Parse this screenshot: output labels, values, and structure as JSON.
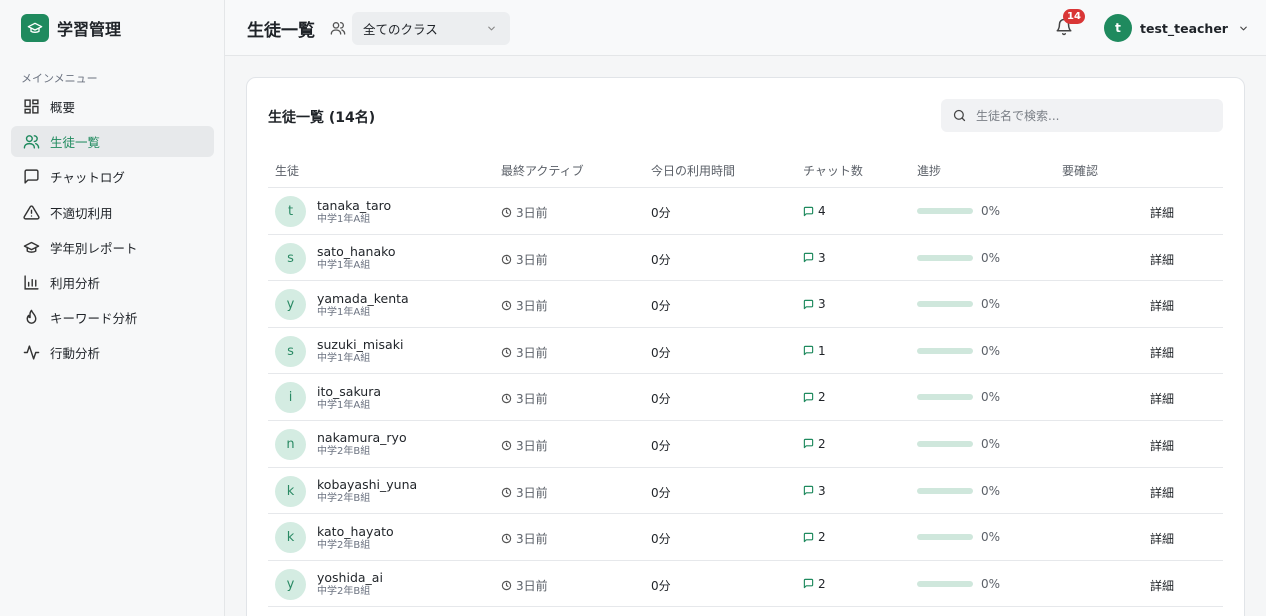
{
  "brand": {
    "title": "学習管理"
  },
  "sidebar": {
    "heading": "メインメニュー",
    "items": [
      {
        "label": "概要",
        "icon": "dashboard-icon",
        "active": false
      },
      {
        "label": "生徒一覧",
        "icon": "users-icon",
        "active": true
      },
      {
        "label": "チャットログ",
        "icon": "chat-icon",
        "active": false
      },
      {
        "label": "不適切利用",
        "icon": "warning-icon",
        "active": false
      },
      {
        "label": "学年別レポート",
        "icon": "graduation-cap-icon",
        "active": false
      },
      {
        "label": "利用分析",
        "icon": "bar-chart-icon",
        "active": false
      },
      {
        "label": "キーワード分析",
        "icon": "flame-icon",
        "active": false
      },
      {
        "label": "行動分析",
        "icon": "activity-icon",
        "active": false
      }
    ]
  },
  "header": {
    "title": "生徒一覧",
    "class_filter": "全てのクラス",
    "notifications": "14",
    "user_initial": "t",
    "user_name": "test_teacher"
  },
  "card": {
    "title": "生徒一覧 (14名)",
    "search_placeholder": "生徒名で検索...",
    "columns": [
      "生徒",
      "最終アクティブ",
      "今日の利用時間",
      "チャット数",
      "進捗",
      "要確認"
    ],
    "rows": [
      {
        "initial": "t",
        "name": "tanaka_taro",
        "class": "中学1年A組",
        "last_active": "3日前",
        "usage": "0分",
        "chats": "4",
        "progress": 0,
        "progress_label": "0%",
        "action": "詳細"
      },
      {
        "initial": "s",
        "name": "sato_hanako",
        "class": "中学1年A組",
        "last_active": "3日前",
        "usage": "0分",
        "chats": "3",
        "progress": 0,
        "progress_label": "0%",
        "action": "詳細"
      },
      {
        "initial": "y",
        "name": "yamada_kenta",
        "class": "中学1年A組",
        "last_active": "3日前",
        "usage": "0分",
        "chats": "3",
        "progress": 0,
        "progress_label": "0%",
        "action": "詳細"
      },
      {
        "initial": "s",
        "name": "suzuki_misaki",
        "class": "中学1年A組",
        "last_active": "3日前",
        "usage": "0分",
        "chats": "1",
        "progress": 0,
        "progress_label": "0%",
        "action": "詳細"
      },
      {
        "initial": "i",
        "name": "ito_sakura",
        "class": "中学1年A組",
        "last_active": "3日前",
        "usage": "0分",
        "chats": "2",
        "progress": 0,
        "progress_label": "0%",
        "action": "詳細"
      },
      {
        "initial": "n",
        "name": "nakamura_ryo",
        "class": "中学2年B組",
        "last_active": "3日前",
        "usage": "0分",
        "chats": "2",
        "progress": 0,
        "progress_label": "0%",
        "action": "詳細"
      },
      {
        "initial": "k",
        "name": "kobayashi_yuna",
        "class": "中学2年B組",
        "last_active": "3日前",
        "usage": "0分",
        "chats": "3",
        "progress": 0,
        "progress_label": "0%",
        "action": "詳細"
      },
      {
        "initial": "k",
        "name": "kato_hayato",
        "class": "中学2年B組",
        "last_active": "3日前",
        "usage": "0分",
        "chats": "2",
        "progress": 0,
        "progress_label": "0%",
        "action": "詳細"
      },
      {
        "initial": "y",
        "name": "yoshida_ai",
        "class": "中学2年B組",
        "last_active": "3日前",
        "usage": "0分",
        "chats": "2",
        "progress": 0,
        "progress_label": "0%",
        "action": "詳細"
      }
    ]
  },
  "colors": {
    "accent": "#1f8a5e",
    "badge": "#d93636",
    "avatar_bg": "#d4ece2"
  }
}
